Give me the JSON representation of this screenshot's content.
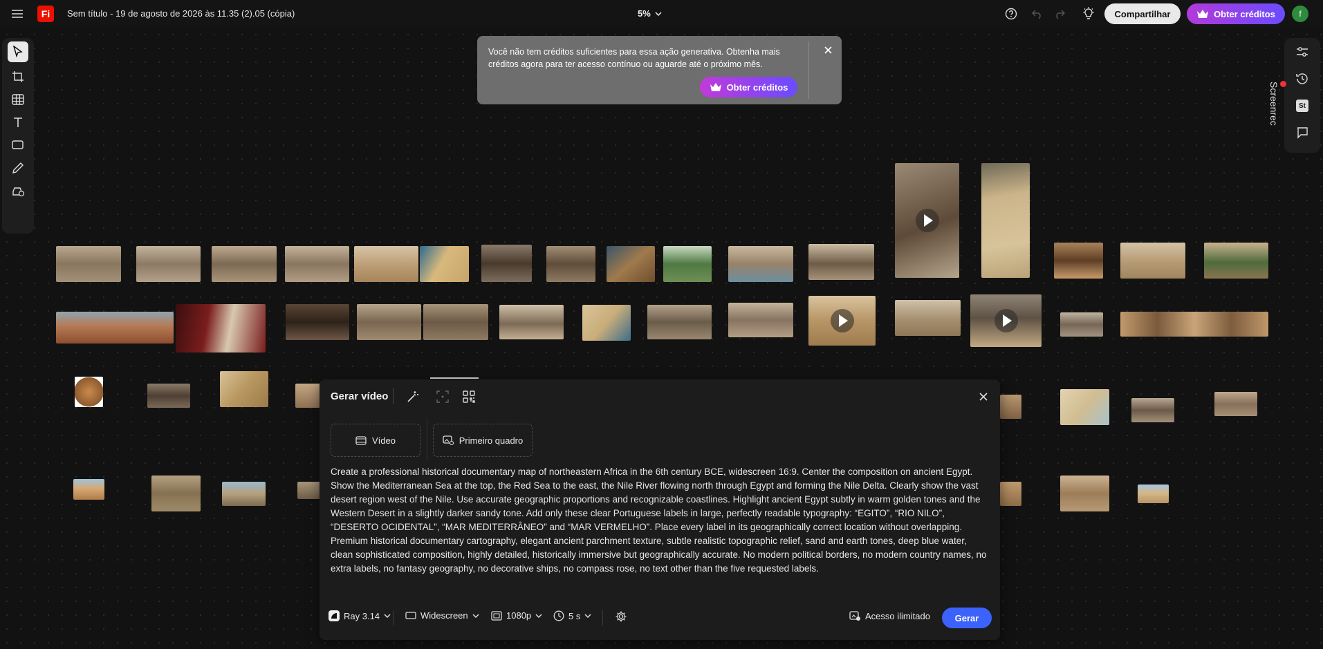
{
  "topbar": {
    "menu_icon": "hamburger-icon",
    "app_logo": "Fi",
    "document_title": "Sem título - 19 de agosto de 2026 às 11.35 (2).05 (cópia)",
    "zoom": "5%",
    "share_label": "Compartilhar",
    "credits_label": "Obter créditos",
    "avatar_initial": "f"
  },
  "left_toolbar": {
    "tools": [
      "select-tool",
      "frame-tool",
      "grid-tool",
      "text-tool",
      "shape-tool",
      "pen-tool",
      "generate-tool"
    ]
  },
  "right_toolbar": {
    "tools": [
      "adjust-tool",
      "history-tool",
      "stock-tool",
      "comment-tool"
    ],
    "stock_label": "St"
  },
  "screen_recorder_label": "Screenrec",
  "notification": {
    "message": "Você não tem créditos suficientes para essa ação generativa. Obtenha mais créditos agora para ter acesso contínuo ou aguarde até o próximo mês.",
    "button_label": "Obter créditos"
  },
  "generate_panel": {
    "title": "Gerar vídeo",
    "slot_video": "Vídeo",
    "slot_first_frame": "Primeiro quadro",
    "prompt": "Create a professional historical documentary map of northeastern Africa in the 6th century BCE, widescreen 16:9. Center the composition on ancient Egypt. Show the Mediterranean Sea at the top, the Red Sea to the east, the Nile River flowing north through Egypt and forming the Nile Delta. Clearly show the vast desert region west of the Nile. Use accurate geographic proportions and recognizable coastlines. Highlight ancient Egypt subtly in warm golden tones and the Western Desert in a slightly darker sandy tone. Add only these clear Portuguese labels in large, perfectly readable typography: “EGITO”, “RIO NILO”, “DESERTO OCIDENTAL”, “MAR MEDITERRÂNEO” and “MAR VERMELHO”. Place every label in its geographically correct location without overlapping. Premium historical documentary cartography, elegant ancient parchment texture, subtle realistic topographic relief, sand and earth tones, deep blue water, clean sophisticated composition, highly detailed, historically immersive but geographically accurate. No modern political borders, no modern country names, no extra labels, no fantasy geography, no decorative ships, no compass rose, no text other than the five requested labels.",
    "model": "Ray 3.14",
    "aspect": "Widescreen",
    "resolution": "1080p",
    "duration": "5 s",
    "unlimited_label": "Acesso ilimitado",
    "generate_label": "Gerar"
  },
  "colors": {
    "canvas": "#121212",
    "accent_blue": "#3b63fb",
    "credits_gradient_start": "#b23ad8",
    "credits_gradient_end": "#6a4cff",
    "logo_red": "#eb1000"
  }
}
